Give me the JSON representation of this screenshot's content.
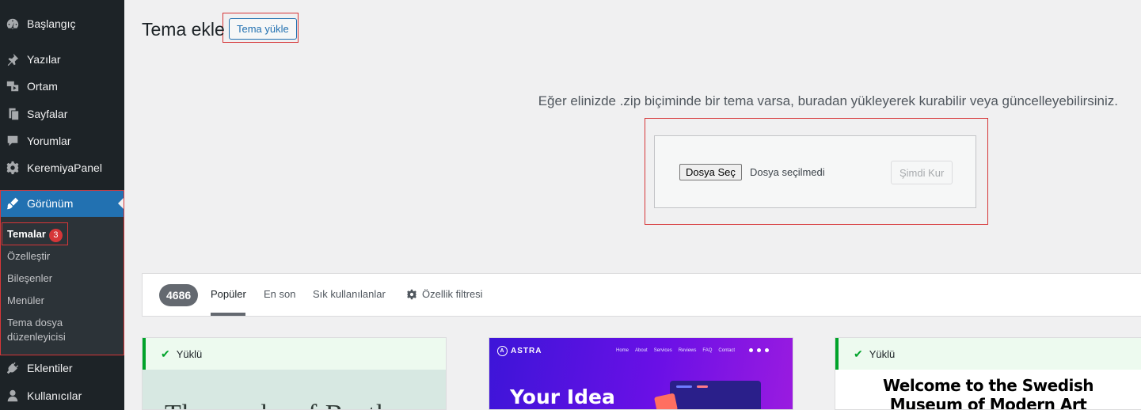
{
  "sidebar": {
    "items": [
      {
        "label": "Başlangıç",
        "icon": "dashboard-icon"
      },
      {
        "label": "Yazılar",
        "icon": "pin-icon"
      },
      {
        "label": "Ortam",
        "icon": "media-icon"
      },
      {
        "label": "Sayfalar",
        "icon": "pages-icon"
      },
      {
        "label": "Yorumlar",
        "icon": "comments-icon"
      },
      {
        "label": "KeremiyaPanel",
        "icon": "gear-icon"
      },
      {
        "label": "Görünüm",
        "icon": "appearance-brush-icon"
      },
      {
        "label": "Eklentiler",
        "icon": "plugins-icon"
      },
      {
        "label": "Kullanıcılar",
        "icon": "users-icon"
      }
    ],
    "submenu": {
      "items": [
        {
          "label": "Temalar",
          "badge": "3"
        },
        {
          "label": "Özelleştir"
        },
        {
          "label": "Bileşenler"
        },
        {
          "label": "Menüler"
        },
        {
          "label": "Tema dosya"
        },
        {
          "label": "düzenleyicisi"
        }
      ]
    }
  },
  "header": {
    "title": "Tema ekle",
    "upload_button": "Tema yükle"
  },
  "upload": {
    "help_text": "Eğer elinizde .zip biçiminde bir tema varsa, buradan yükleyerek kurabilir veya güncelleyebilirsiniz.",
    "choose_file": "Dosya Seç",
    "no_file": "Dosya seçilmedi",
    "install_button": "Şimdi Kur"
  },
  "filter": {
    "count": "4686",
    "tabs": [
      "Popüler",
      "En son",
      "Sık kullanılanlar"
    ],
    "feature_filter": "Özellik filtresi"
  },
  "themes": {
    "card1": {
      "status": "Yüklü",
      "preview_text": "The works of Borth"
    },
    "card2": {
      "logo": "ASTRA",
      "nav": [
        "Home",
        "About",
        "Services",
        "Reviews",
        "FAQ",
        "Contact"
      ],
      "hero": "Your Idea"
    },
    "card3": {
      "status": "Yüklü",
      "line1": "Welcome to the Swedish",
      "line2": "Museum of Modern Art"
    }
  },
  "colors": {
    "sidebar_bg": "#1d2327",
    "submenu_bg": "#2c3338",
    "accent": "#2271b1",
    "badge": "#d63638",
    "success": "#00a32a",
    "highlight_box": "#d63638"
  }
}
